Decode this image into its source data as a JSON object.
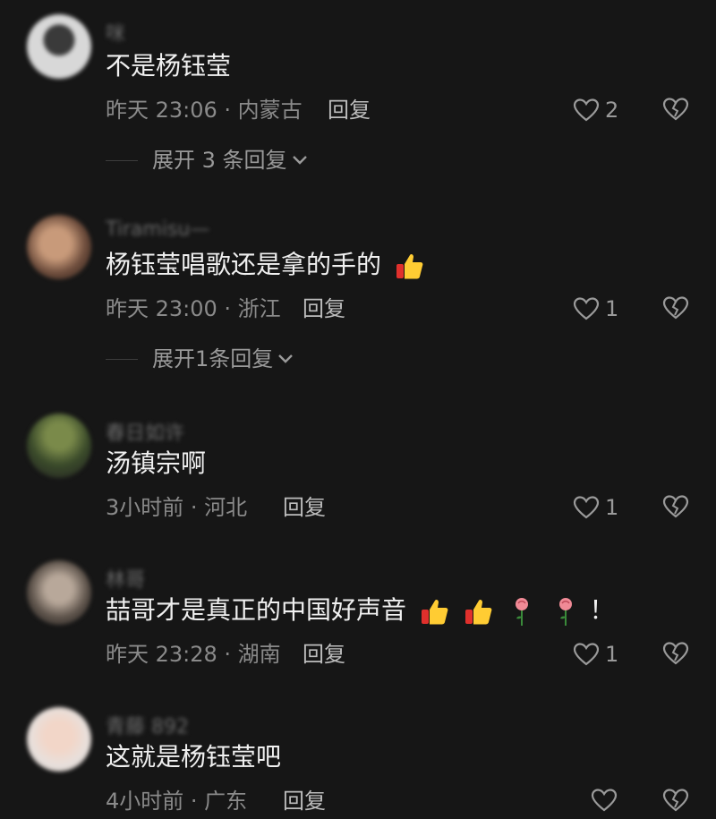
{
  "comments": [
    {
      "username": "咪",
      "text": "不是杨钰莹",
      "meta": "昨天 23:06 · 内蒙古",
      "reply_label": "回复",
      "likes": "2",
      "expand_label": "展开 3 条回复"
    },
    {
      "username": "Tiramisu—",
      "text": "杨钰莹唱歌还是拿的手的",
      "meta": "昨天 23:00 · 浙江",
      "reply_label": "回复",
      "likes": "1",
      "expand_label": "展开1条回复"
    },
    {
      "username": "春日如许",
      "text": "汤镇宗啊",
      "meta": "3小时前 · 河北",
      "reply_label": "回复",
      "likes": "1"
    },
    {
      "username": "林哥",
      "text": "喆哥才是真正的中国好声音",
      "text_suffix": "！",
      "meta": "昨天 23:28 · 湖南",
      "reply_label": "回复",
      "likes": "1"
    },
    {
      "username": "青藤 892",
      "text": "这就是杨钰莹吧",
      "meta": "4小时前 · 广东",
      "reply_label": "回复",
      "likes": ""
    }
  ],
  "colors": {
    "background": "#161616",
    "text": "#f0f0f0",
    "meta": "#8a8a8a",
    "icon": "#9a9a9a"
  },
  "icons": [
    "heart-icon",
    "broken-heart-icon",
    "chevron-down-icon",
    "thumbs-up-emoji",
    "rose-emoji"
  ]
}
